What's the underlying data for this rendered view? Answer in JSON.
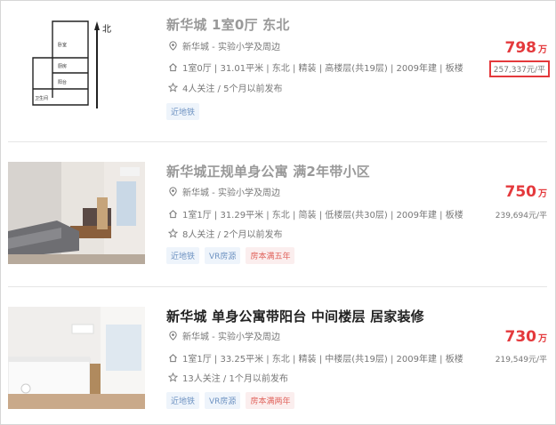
{
  "listings": [
    {
      "title": "新华城 1室0厅 东北",
      "location": "新华城 - 实验小学及周边",
      "details": "1室0厅 | 31.01平米 | 东北 | 精装 | 高楼层(共19层) | 2009年建 | 板楼",
      "follow": "4人关注 / 5个月以前发布",
      "tags": [
        "近地铁"
      ],
      "price": "798",
      "price_unit": "万",
      "unit_price": "257,337元/平",
      "floorplan": {
        "north_label": "北",
        "rooms": [
          "卧室",
          "厨房",
          "阳台",
          "卫生间"
        ]
      }
    },
    {
      "title": "新华城正规单身公寓 满2年带小区",
      "location": "新华城 - 实验小学及周边",
      "details": "1室1厅 | 31.29平米 | 东北 | 简装 | 低楼层(共30层) | 2009年建 | 板楼",
      "follow": "8人关注 / 2个月以前发布",
      "tags": [
        "近地铁",
        "VR房源",
        "房本满五年"
      ],
      "price": "750",
      "price_unit": "万",
      "unit_price": "239,694元/平"
    },
    {
      "title": "新华城 单身公寓带阳台 中间楼层 居家装修",
      "location": "新华城 - 实验小学及周边",
      "details": "1室1厅 | 33.25平米 | 东北 | 精装 | 中楼层(共19层) | 2009年建 | 板楼",
      "follow": "13人关注 / 1个月以前发布",
      "tags": [
        "近地铁",
        "VR房源",
        "房本满两年"
      ],
      "price": "730",
      "price_unit": "万",
      "unit_price": "219,549元/平"
    }
  ],
  "colors": {
    "accent": "#e4393c",
    "tag_blue": "#6f93c2",
    "tag_red": "#e0635c"
  },
  "icons": [
    "location-icon",
    "house-icon",
    "star-icon"
  ]
}
